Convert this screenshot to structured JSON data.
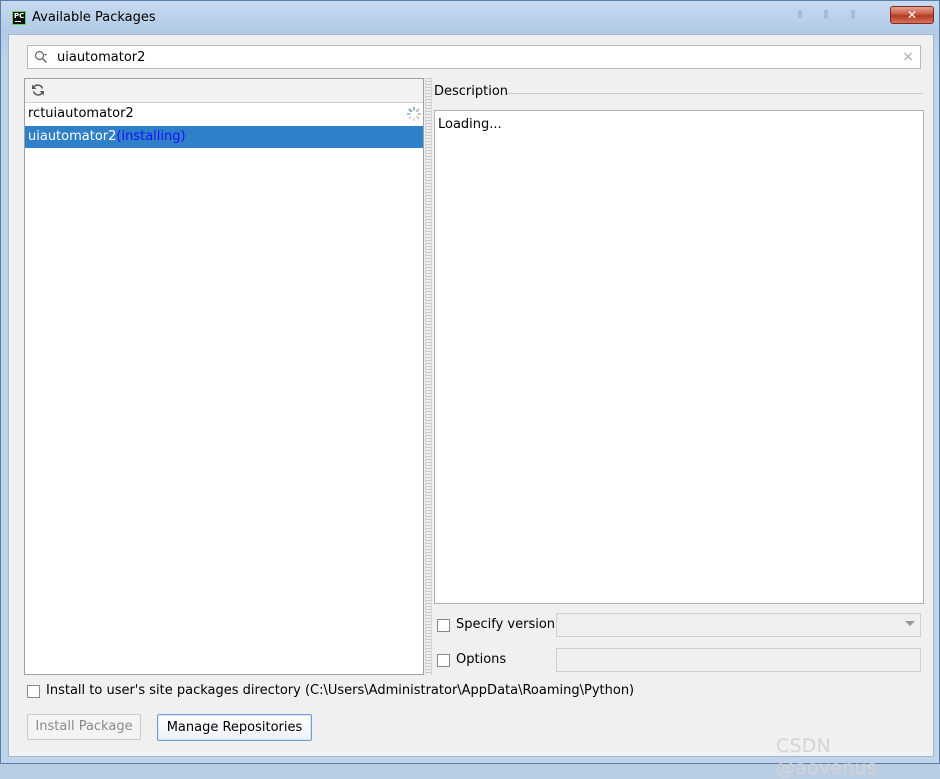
{
  "window": {
    "title": "Available Packages",
    "close_label": "✕"
  },
  "search": {
    "value": "uiautomator2",
    "placeholder": ""
  },
  "packages": {
    "rows": [
      {
        "name": "rctuiautomator2",
        "status": ""
      },
      {
        "name": "uiautomator2",
        "status": "(installing)"
      }
    ]
  },
  "description": {
    "label": "Description",
    "text": "Loading..."
  },
  "specify_version": {
    "label": "Specify version",
    "checked": false
  },
  "options": {
    "label": "Options",
    "checked": false
  },
  "install_user": {
    "label": "Install to user's site packages directory (C:\\Users\\Administrator\\AppData\\Roaming\\Python)",
    "checked": false
  },
  "buttons": {
    "install": "Install Package",
    "manage": "Manage Repositories"
  },
  "watermark": "CSDN @aovenus",
  "colors": {
    "selection": "#2f7fc9",
    "installing": "#1313ff",
    "window_frame": "#b9cde3"
  },
  "icons": {
    "search": "search-icon",
    "refresh": "refresh-icon",
    "spinner": "loading-spinner-icon",
    "clear": "clear-icon",
    "dropdown": "chevron-down-icon",
    "app": "pycharm-icon"
  }
}
